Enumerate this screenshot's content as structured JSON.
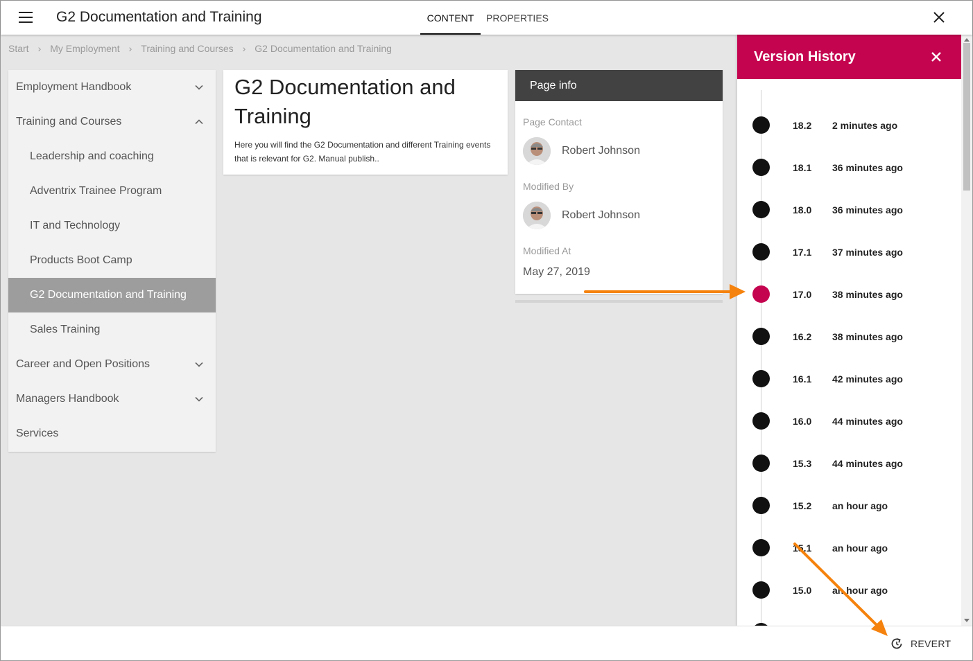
{
  "header": {
    "title": "G2 Documentation and Training",
    "tabs": [
      {
        "label": "CONTENT",
        "active": true
      },
      {
        "label": "PROPERTIES",
        "active": false
      }
    ],
    "menu_icon": "hamburger-icon",
    "close_icon": "close-icon"
  },
  "breadcrumb": [
    "Start",
    "My Employment",
    "Training and Courses",
    "G2 Documentation and Training"
  ],
  "sidebar": {
    "items": [
      {
        "label": "Employment Handbook",
        "expandable": true,
        "expanded": false
      },
      {
        "label": "Training and Courses",
        "expandable": true,
        "expanded": true
      },
      {
        "label": "Leadership and coaching",
        "child": true
      },
      {
        "label": "Adventrix Trainee Program",
        "child": true
      },
      {
        "label": "IT and Technology",
        "child": true
      },
      {
        "label": "Products Boot Camp",
        "child": true
      },
      {
        "label": "G2 Documentation and Training",
        "child": true,
        "active": true
      },
      {
        "label": "Sales Training",
        "child": true
      },
      {
        "label": "Career and Open Positions",
        "expandable": true,
        "expanded": false
      },
      {
        "label": "Managers Handbook",
        "expandable": true,
        "expanded": false
      },
      {
        "label": "Services"
      }
    ]
  },
  "content": {
    "title": "G2 Documentation and Training",
    "description": "Here you will find the G2 Documentation and different Training events that is relevant for G2. Manual publish.."
  },
  "page_info": {
    "header": "Page info",
    "contact_label": "Page Contact",
    "contact_name": "Robert Johnson",
    "modified_by_label": "Modified By",
    "modified_by_name": "Robert Johnson",
    "modified_at_label": "Modified At",
    "modified_at": "May 27, 2019"
  },
  "version_history": {
    "title": "Version History",
    "accent": "#c4044f",
    "versions": [
      {
        "version": "18.2",
        "time": "2 minutes ago"
      },
      {
        "version": "18.1",
        "time": "36 minutes ago"
      },
      {
        "version": "18.0",
        "time": "36 minutes ago"
      },
      {
        "version": "17.1",
        "time": "37 minutes ago"
      },
      {
        "version": "17.0",
        "time": "38 minutes ago",
        "selected": true
      },
      {
        "version": "16.2",
        "time": "38 minutes ago"
      },
      {
        "version": "16.1",
        "time": "42 minutes ago"
      },
      {
        "version": "16.0",
        "time": "44 minutes ago"
      },
      {
        "version": "15.3",
        "time": "44 minutes ago"
      },
      {
        "version": "15.2",
        "time": "an hour ago"
      },
      {
        "version": "15.1",
        "time": "an hour ago"
      },
      {
        "version": "15.0",
        "time": "an hour ago"
      }
    ]
  },
  "footer": {
    "revert_label": "REVERT",
    "revert_icon": "revert-icon"
  },
  "annotation_color": "#f5820c"
}
